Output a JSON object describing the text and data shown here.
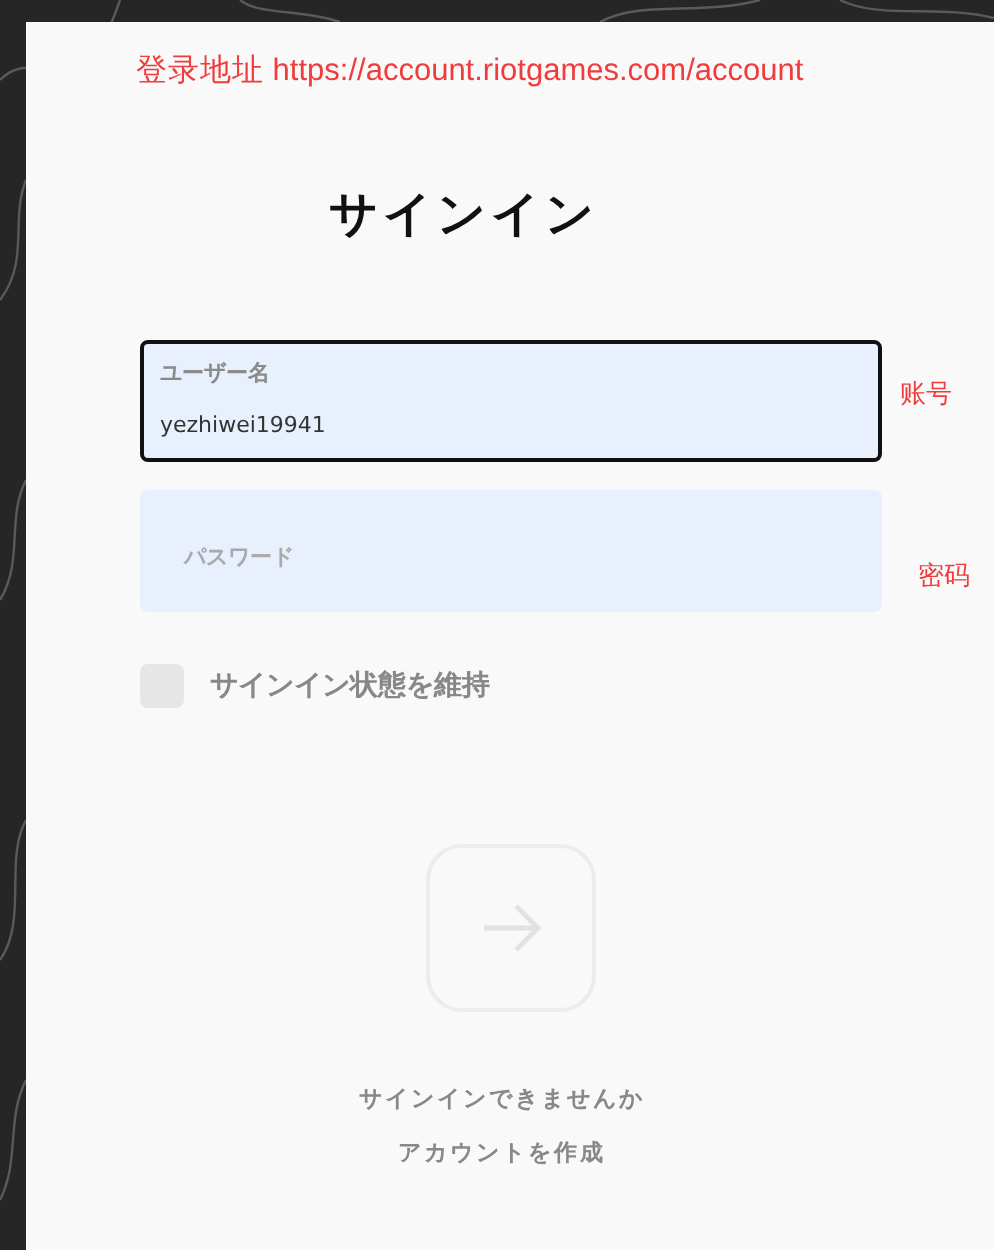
{
  "annotation": {
    "text": "登录地址 https://account.riotgames.com/account"
  },
  "title": "サインイン",
  "fields": [
    {
      "label": "ユーザー名",
      "value": "yezhiwei19941",
      "focused": true,
      "note": "账号"
    },
    {
      "label": "パスワード",
      "focused": false,
      "note": "密码"
    }
  ],
  "remember": {
    "label": "サインイン状態を維持",
    "checked": false
  },
  "submit": {
    "disabled": true
  },
  "links": [
    "サインインできませんか",
    "アカウントを作成"
  ]
}
